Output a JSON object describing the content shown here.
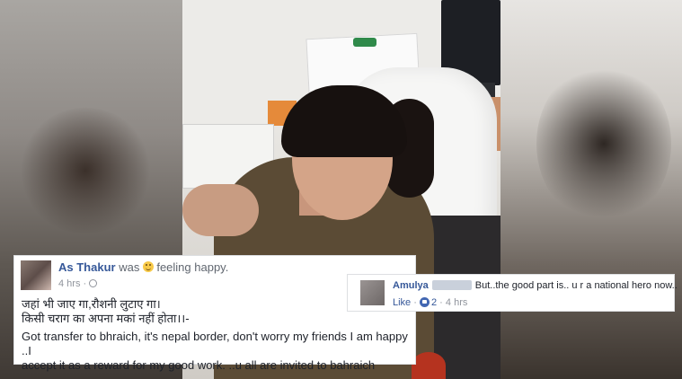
{
  "post": {
    "author": "As Thakur",
    "was_text": "was",
    "feeling_text": "feeling happy.",
    "time": "4 hrs",
    "body_line1": "जहां भी जाए गा,रौशनी लुटाए गा।",
    "body_line2": "किसी चराग का अपना मकां नहीं होता।।-",
    "body_line3": "Got transfer to bhraich, it's nepal border, don't worry my friends I am happy ..I",
    "body_line4": "accept it as a reward for my good work. ..u all are invited to bahraich"
  },
  "comment": {
    "author": "Amulya",
    "text": "But..the good part is.. u r a national hero now..",
    "like_label": "Like",
    "separator": "·",
    "reaction_count": "2",
    "time": "4 hrs"
  },
  "icons": {
    "emoji": "smiley-emoji-icon",
    "audience": "globe-icon",
    "reaction": "like-reaction-icon"
  },
  "colors": {
    "link_blue": "#365899",
    "text": "#1d2129",
    "muted": "#90949c"
  }
}
